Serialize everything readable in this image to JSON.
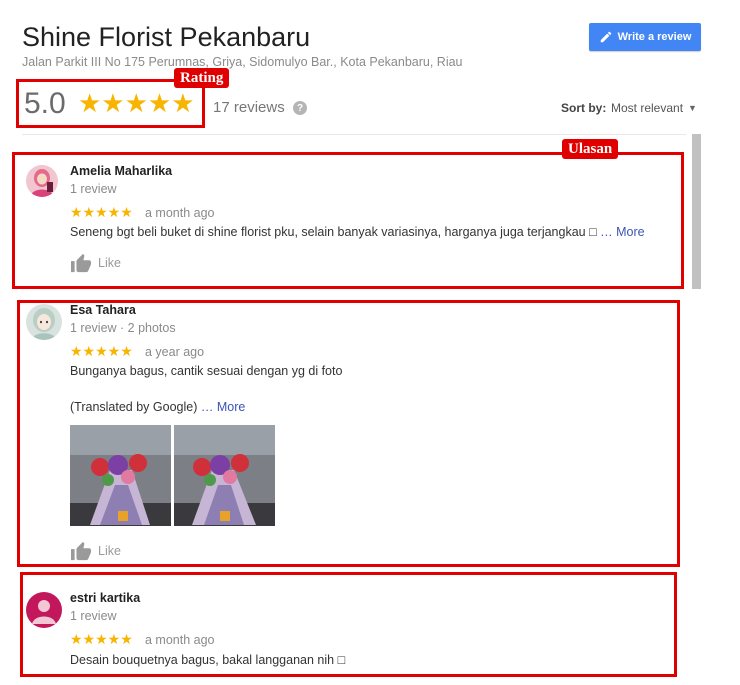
{
  "header": {
    "title": "Shine Florist Pekanbaru",
    "address": "Jalan Parkit III No 175 Perumnas, Griya, Sidomulyo Bar., Kota Pekanbaru, Riau",
    "write_review_label": "Write a review"
  },
  "summary": {
    "rating": "5.0",
    "stars": "★★★★★",
    "reviews_count": "17 reviews",
    "help_glyph": "?"
  },
  "sort": {
    "label": "Sort by:",
    "value": "Most relevant"
  },
  "annotations": {
    "rating_tag": "Rating",
    "ulasan_tag": "Ulasan"
  },
  "reviews": [
    {
      "name": "Amelia Maharlika",
      "meta": "1 review",
      "stars": "★★★★★",
      "date": "a month ago",
      "text": "Seneng bgt beli buket di shine florist pku, selain banyak variasinya, harganya juga terjangkau □",
      "more": "… More",
      "like": "Like"
    },
    {
      "name": "Esa Tahara",
      "meta": "1 review · 2 photos",
      "stars": "★★★★★",
      "date": "a year ago",
      "text": "Bunganya bagus, cantik sesuai dengan yg di foto",
      "translated": "(Translated by Google)",
      "more": "… More",
      "like": "Like"
    },
    {
      "name": "estri kartika",
      "meta": "1 review",
      "stars": "★★★★★",
      "date": "a month ago",
      "text": "Desain bouquetnya bagus, bakal langganan nih □"
    }
  ],
  "colors": {
    "accent": "#4285f4",
    "star": "#f7b400",
    "annotation": "#e00000",
    "link": "#3a55b4"
  },
  "icons": [
    "pencil-icon",
    "help-icon",
    "caret-down-icon",
    "thumbs-up-icon"
  ]
}
